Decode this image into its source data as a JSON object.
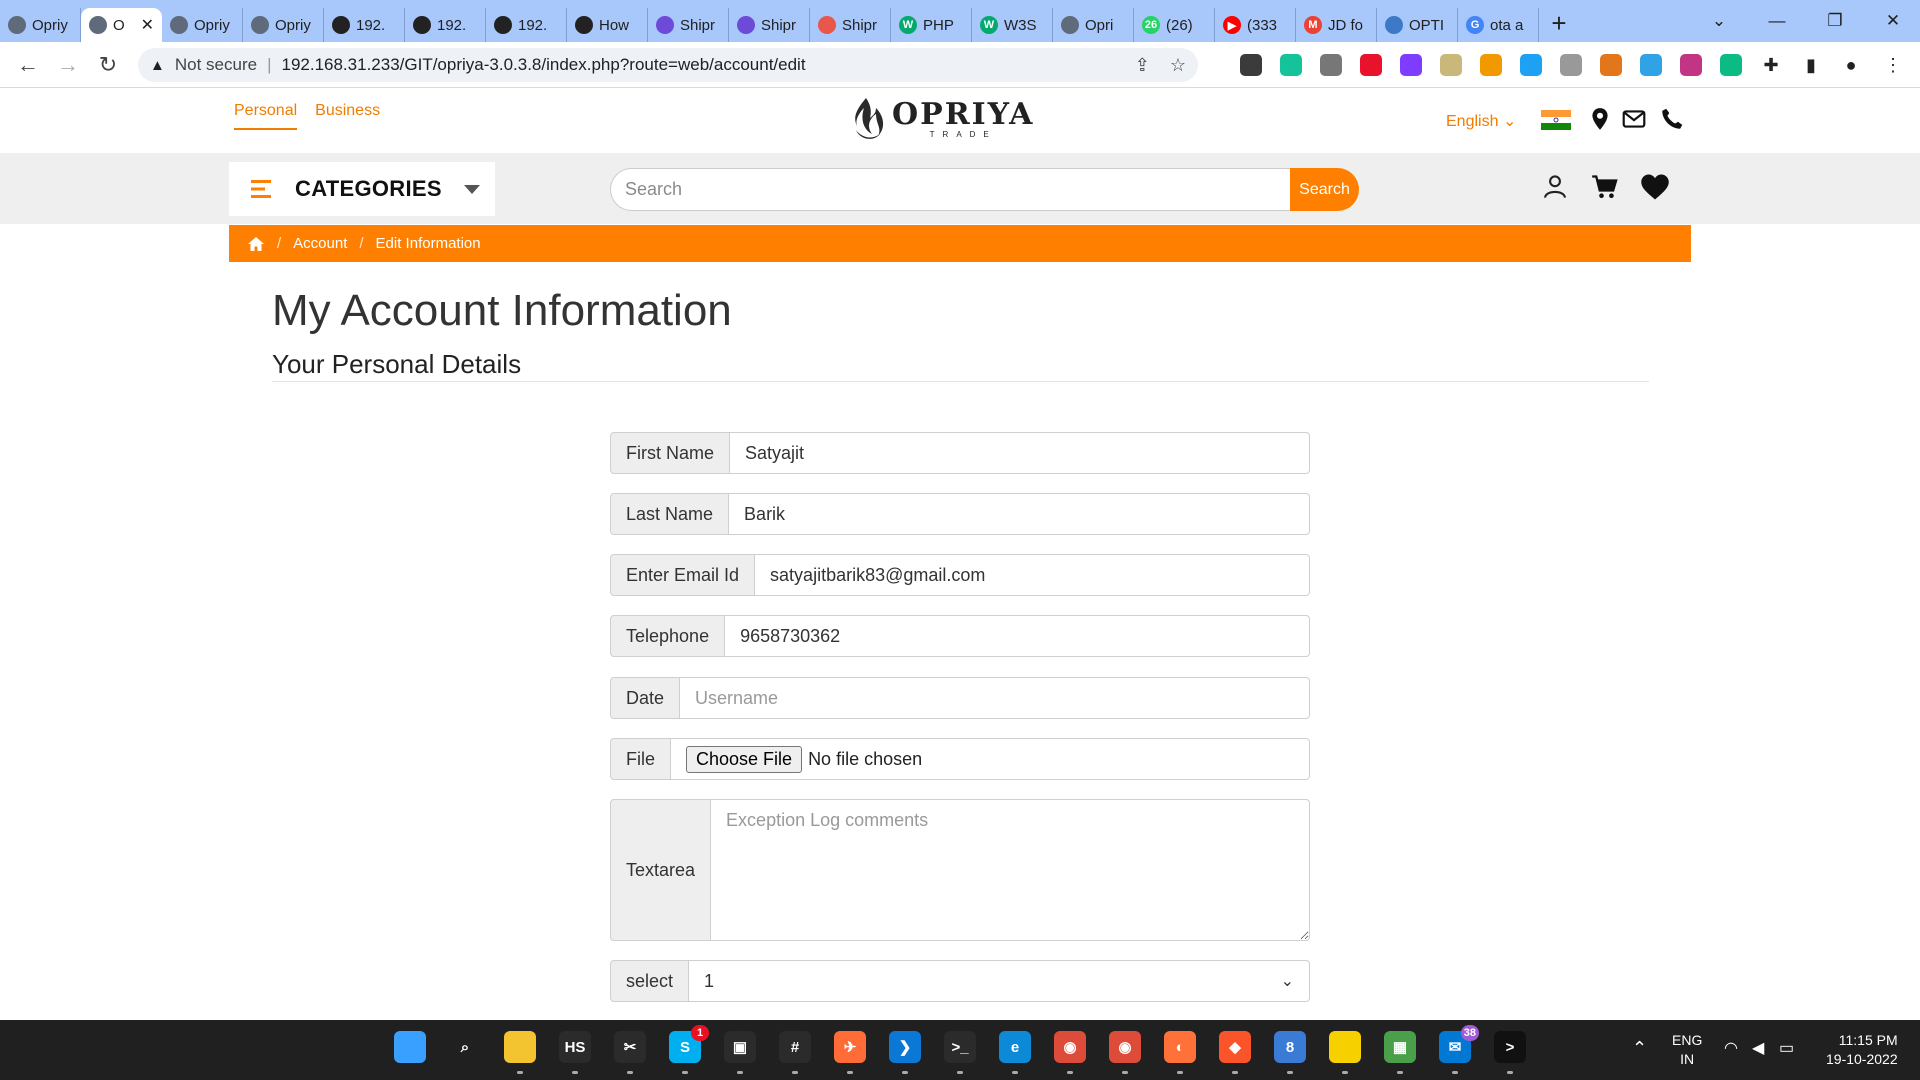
{
  "browser": {
    "tabs": [
      {
        "label": "Opriy",
        "color": "#5f6b7a",
        "glyph": ""
      },
      {
        "label": "O",
        "color": "#5f6b7a",
        "glyph": "",
        "active": true
      },
      {
        "label": "Opriy",
        "color": "#5f6b7a",
        "glyph": ""
      },
      {
        "label": "Opriy",
        "color": "#5f6b7a",
        "glyph": ""
      },
      {
        "label": "192.",
        "color": "#222222",
        "glyph": ""
      },
      {
        "label": "192.",
        "color": "#222222",
        "glyph": ""
      },
      {
        "label": "192.",
        "color": "#222222",
        "glyph": ""
      },
      {
        "label": "How",
        "color": "#222222",
        "glyph": ""
      },
      {
        "label": "Shipr",
        "color": "#6d4bd8",
        "glyph": ""
      },
      {
        "label": "Shipr",
        "color": "#6d4bd8",
        "glyph": ""
      },
      {
        "label": "Shipr",
        "color": "#e8574a",
        "glyph": ""
      },
      {
        "label": "PHP",
        "color": "#04aa6d",
        "glyph": "W"
      },
      {
        "label": "W3S",
        "color": "#04aa6d",
        "glyph": "W"
      },
      {
        "label": "Opri",
        "color": "#5f6b7a",
        "glyph": ""
      },
      {
        "label": "(26)",
        "color": "#25d366",
        "glyph": "26"
      },
      {
        "label": "(333",
        "color": "#ff0000",
        "glyph": "▶"
      },
      {
        "label": "JD fo",
        "color": "#ea4335",
        "glyph": "M"
      },
      {
        "label": "OPTI",
        "color": "#3c79c6",
        "glyph": ""
      },
      {
        "label": "ota a",
        "color": "#4285f4",
        "glyph": "G"
      }
    ],
    "new_tab": "+",
    "url_warning": "Not secure",
    "url": "192.168.31.233/GIT/opriya-3.0.3.8/index.php?route=web/account/edit",
    "extension_colors": [
      "#3b3b3b",
      "#15c39a",
      "#777777",
      "#e8122d",
      "#7d3cff",
      "#c9b87a",
      "#f29900",
      "#1da1f2",
      "#999999",
      "#e2761b",
      "#2fa3e6",
      "#c13584",
      "#0cba83"
    ]
  },
  "site": {
    "top_links": [
      "Personal",
      "Business"
    ],
    "brand": "OPRIYA",
    "brand_sub": "TRADE",
    "language": "English",
    "categories_label": "CATEGORIES",
    "search_placeholder": "Search",
    "search_button": "Search",
    "breadcrumb": [
      "Account",
      "Edit Information"
    ]
  },
  "page": {
    "title": "My Account Information",
    "subtitle": "Your Personal Details",
    "fields": {
      "first_name": {
        "label": "First Name",
        "value": "Satyajit"
      },
      "last_name": {
        "label": "Last Name",
        "value": "Barik"
      },
      "email": {
        "label": "Enter Email Id",
        "value": "satyajitbarik83@gmail.com"
      },
      "telephone": {
        "label": "Telephone",
        "value": "9658730362"
      },
      "date": {
        "label": "Date",
        "value": "",
        "placeholder": "Username"
      },
      "file": {
        "label": "File",
        "button": "Choose File",
        "status": "No file chosen"
      },
      "textarea": {
        "label": "Textarea",
        "placeholder": "Exception Log comments"
      },
      "select": {
        "label": "select",
        "value": "1"
      }
    }
  },
  "taskbar": {
    "apps": [
      {
        "name": "windows-start",
        "color": "#3aa0ff",
        "text": ""
      },
      {
        "name": "search",
        "color": "transparent",
        "text": "⌕"
      },
      {
        "name": "file-explorer",
        "color": "#f4c430",
        "text": ""
      },
      {
        "name": "hs",
        "color": "#2b2b2b",
        "text": "HS"
      },
      {
        "name": "snipping-tool",
        "color": "#2b2b2b",
        "text": "✂"
      },
      {
        "name": "skype",
        "color": "#00aff0",
        "text": "S",
        "badge": "1"
      },
      {
        "name": "remote",
        "color": "#2b2b2b",
        "text": "▣"
      },
      {
        "name": "slack",
        "color": "#2b2b2b",
        "text": "#"
      },
      {
        "name": "postman",
        "color": "#ff6c37",
        "text": "✈"
      },
      {
        "name": "vscode",
        "color": "#0a78d4",
        "text": "❯"
      },
      {
        "name": "terminal",
        "color": "#2b2b2b",
        "text": ">_"
      },
      {
        "name": "edge",
        "color": "#0c8ad6",
        "text": "e"
      },
      {
        "name": "chrome",
        "color": "#dd4b39",
        "text": "◉"
      },
      {
        "name": "chrome-2",
        "color": "#dd4b39",
        "text": "◉"
      },
      {
        "name": "firefox",
        "color": "#ff7139",
        "text": "◐"
      },
      {
        "name": "brave",
        "color": "#fb542b",
        "text": "◆"
      },
      {
        "name": "app-8",
        "color": "#3a7bd5",
        "text": "8"
      },
      {
        "name": "sticky-notes",
        "color": "#f7d000",
        "text": ""
      },
      {
        "name": "photos",
        "color": "#4a9f4a",
        "text": "▦"
      },
      {
        "name": "mail",
        "color": "#0078d4",
        "text": "✉",
        "badge": "38"
      },
      {
        "name": "cmd",
        "color": "#111111",
        "text": ">"
      }
    ],
    "lang_top": "ENG",
    "lang_bottom": "IN",
    "time": "11:15 PM",
    "date": "19-10-2022"
  }
}
